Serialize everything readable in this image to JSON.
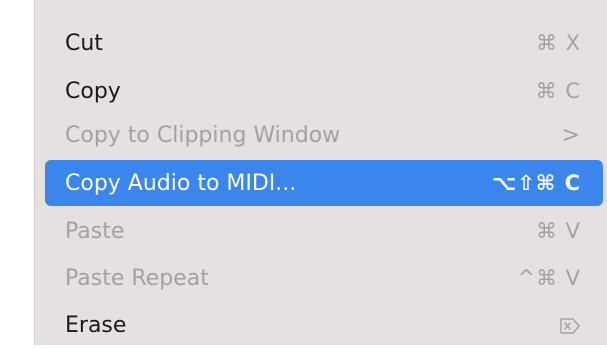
{
  "menu": {
    "items": [
      {
        "label": "Cut",
        "shortcut": "⌘ X",
        "enabled": true
      },
      {
        "label": "Copy",
        "shortcut": "⌘ C",
        "enabled": true
      },
      {
        "label": "Copy to Clipping Window",
        "shortcut": ">",
        "enabled": false,
        "has_submenu": true
      },
      {
        "label": "Copy Audio to MIDI...",
        "shortcut": "⌥⇧⌘ C",
        "enabled": true,
        "selected": true
      },
      {
        "label": "Paste",
        "shortcut": "⌘ V",
        "enabled": false
      },
      {
        "label": "Paste Repeat",
        "shortcut": "^⌘ V",
        "enabled": false
      },
      {
        "label": "Erase",
        "shortcut_icon": "delete-forward-icon",
        "enabled": true
      }
    ]
  },
  "colors": {
    "menu_background": "#e6e0e0",
    "selection": "#3a86ec",
    "enabled_text": "#1a1a1a",
    "disabled_text": "#a5a1a1"
  }
}
